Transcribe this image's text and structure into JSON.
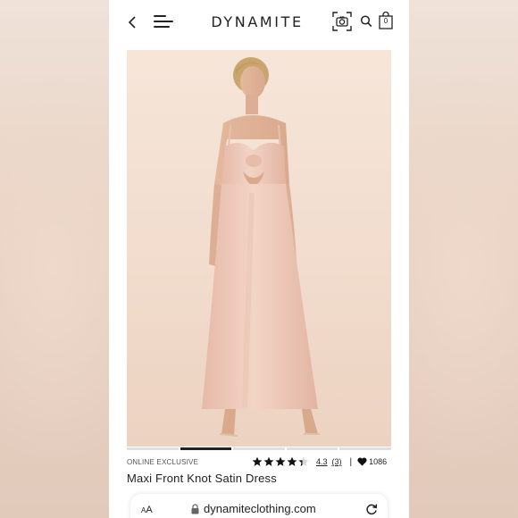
{
  "header": {
    "logo": "DYNAMITE",
    "back_icon": "chevron-left-icon",
    "menu_icon": "hamburger-icon",
    "camera_icon": "camera-search-icon",
    "search_icon": "search-icon",
    "bag_icon": "shopping-bag-icon",
    "bag_count": "0"
  },
  "product": {
    "image_alt": "Maxi Front Knot Satin Dress",
    "carousel": {
      "count": 5,
      "active_index": 1
    },
    "tag": "ONLINE EXCLUSIVE",
    "rating": {
      "stars": 4.3,
      "value": "4.3",
      "count": "(3)"
    },
    "divider": "|",
    "likes": "1086",
    "title": "Maxi Front Knot Satin Dress"
  },
  "browser": {
    "text_size_label_small": "A",
    "text_size_label_large": "A",
    "url": "dynamiteclothing.com",
    "lock_icon": "lock-icon",
    "reload_icon": "reload-icon"
  },
  "colors": {
    "accent": "#222222",
    "dress": "#ecc6b6",
    "backdrop": "#f1dccd"
  }
}
